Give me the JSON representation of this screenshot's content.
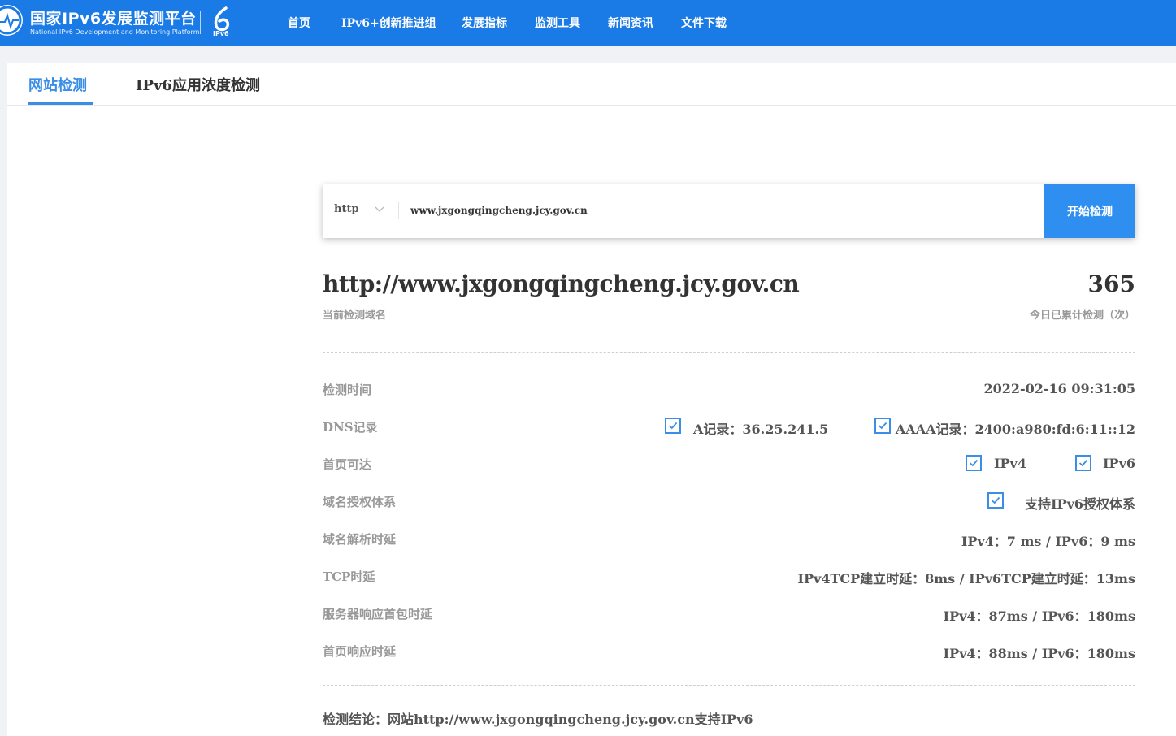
{
  "header": {
    "title": "国家IPv6发展监测平台",
    "subtitle": "National IPv6 Development and Monitoring Platform",
    "ipv6_logo_text": "IPv6",
    "nav": [
      "首页",
      "IPv6+创新推进组",
      "发展指标",
      "监测工具",
      "新闻资讯",
      "文件下载"
    ],
    "brand_color": "#1a7ae6"
  },
  "tabs": [
    "网站检测",
    "IPv6应用浓度检测"
  ],
  "search": {
    "protocol": "http",
    "value": "www.jxgongqingcheng.jcy.gov.cn",
    "button": "开始检测"
  },
  "result": {
    "domain": "http://www.jxgongqingcheng.jcy.gov.cn",
    "domain_label": "当前检测域名",
    "count": "365",
    "count_label": "今日已累计检测（次）"
  },
  "details": {
    "time": {
      "label": "检测时间",
      "value": "2022-02-16 09:31:05"
    },
    "dns": {
      "label": "DNS记录",
      "a": "A记录：36.25.241.5",
      "aaaa": "AAAA记录：2400:a980:fd:6:11::12"
    },
    "homepage": {
      "label": "首页可达",
      "v4": "IPv4",
      "v6": "IPv6"
    },
    "authority": {
      "label": "域名授权体系",
      "value": "支持IPv6授权体系"
    },
    "dns_latency": {
      "label": "域名解析时延",
      "value": "IPv4：7 ms / IPv6：9 ms"
    },
    "tcp": {
      "label": "TCP时延",
      "value": "IPv4TCP建立时延：8ms / IPv6TCP建立时延：13ms"
    },
    "first_packet": {
      "label": "服务器响应首包时延",
      "value": "IPv4：87ms / IPv6：180ms"
    },
    "page_response": {
      "label": "首页响应时延",
      "value": "IPv4：88ms / IPv6：180ms"
    }
  },
  "conclusion": "检测结论：网站http://www.jxgongqingcheng.jcy.gov.cn支持IPv6"
}
